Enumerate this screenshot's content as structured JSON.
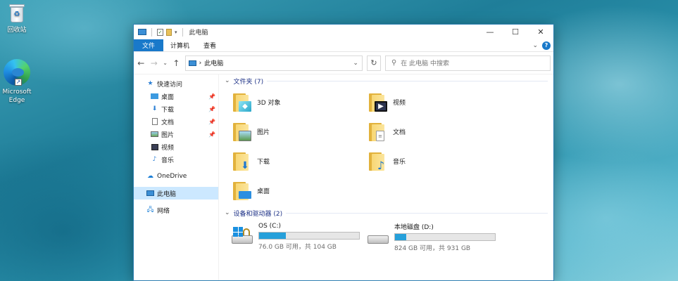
{
  "desktop": {
    "icons": [
      {
        "label": "回收站",
        "icon": "recycle-bin-icon"
      },
      {
        "label": "Microsoft Edge",
        "icon": "edge-icon"
      }
    ]
  },
  "window": {
    "title": "此电脑",
    "controls": {
      "minimize": "—",
      "maximize": "☐",
      "close": "✕"
    },
    "ribbon": {
      "tabs": [
        "文件",
        "计算机",
        "查看"
      ],
      "expand": "⌄",
      "help": "?"
    },
    "address": {
      "back": "←",
      "forward": "→",
      "history": "⌄",
      "up": "↑",
      "separator": "›",
      "path": "此电脑",
      "dropdown": "⌄",
      "refresh": "↻",
      "search_placeholder": "在 此电脑 中搜索"
    },
    "navpane": {
      "quick_access": "快速访问",
      "quick_items": [
        {
          "label": "桌面",
          "pinned": true
        },
        {
          "label": "下载",
          "pinned": true
        },
        {
          "label": "文档",
          "pinned": true
        },
        {
          "label": "图片",
          "pinned": true
        },
        {
          "label": "视频",
          "pinned": false
        },
        {
          "label": "音乐",
          "pinned": false
        }
      ],
      "onedrive": "OneDrive",
      "this_pc": "此电脑",
      "network": "网络",
      "pin_glyph": "📌"
    },
    "folders_header": "文件夹 (7)",
    "folders": [
      {
        "label": "3D 对象",
        "badge": "3d"
      },
      {
        "label": "视频",
        "badge": "video"
      },
      {
        "label": "图片",
        "badge": "pictures"
      },
      {
        "label": "文档",
        "badge": "documents"
      },
      {
        "label": "下载",
        "badge": "downloads"
      },
      {
        "label": "音乐",
        "badge": "music"
      },
      {
        "label": "桌面",
        "badge": "desktop"
      }
    ],
    "devices_header": "设备和驱动器 (2)",
    "drives": [
      {
        "label": "OS (C:)",
        "size": "76.0 GB 可用，共 104 GB",
        "used_fraction": 0.27
      },
      {
        "label": "本地磁盘 (D:)",
        "size": "824 GB 可用，共 931 GB",
        "used_fraction": 0.11
      }
    ]
  }
}
